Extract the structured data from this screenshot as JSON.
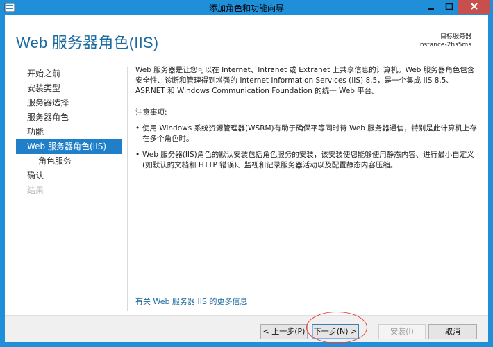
{
  "window": {
    "title": "添加角色和功能向导",
    "controls": {
      "minimize": "minimize-icon",
      "maximize": "maximize-icon",
      "close": "close-icon"
    }
  },
  "header": {
    "page_title": "Web 服务器角色(IIS)",
    "target_label": "目标服务器",
    "target_server": "instance-2hs5ms"
  },
  "nav": {
    "items": [
      {
        "label": "开始之前",
        "state": "normal"
      },
      {
        "label": "安装类型",
        "state": "normal"
      },
      {
        "label": "服务器选择",
        "state": "normal"
      },
      {
        "label": "服务器角色",
        "state": "normal"
      },
      {
        "label": "功能",
        "state": "normal"
      },
      {
        "label": "Web 服务器角色(IIS)",
        "state": "active"
      },
      {
        "label": "角色服务",
        "state": "sub"
      },
      {
        "label": "确认",
        "state": "normal"
      },
      {
        "label": "结果",
        "state": "disabled"
      }
    ]
  },
  "content": {
    "intro": "Web 服务器是让您可以在 Internet、Intranet 或 Extranet 上共享信息的计算机。Web 服务器角色包含安全性、诊断和管理得到增强的 Internet Information Services (IIS) 8.5，是一个集成 IIS 8.5、ASP.NET 和 Windows Communication Foundation 的统一 Web 平台。",
    "notes_title": "注意事项:",
    "bullets": [
      "使用 Windows 系统资源管理器(WSRM)有助于确保平等同时待 Web 服务器通信，特别是此计算机上存在多个角色时。",
      "Web 服务器(IIS)角色的默认安装包括角色服务的安装，该安装使您能够使用静态内容、进行最小自定义(如默认的文档和 HTTP 错误)、监视和记录服务器活动以及配置静态内容压缩。"
    ],
    "more_link": "有关 Web 服务器 IIS 的更多信息"
  },
  "footer": {
    "prev": "< 上一步(P)",
    "next": "下一步(N) >",
    "install": "安装(I)",
    "cancel": "取消"
  },
  "colors": {
    "title_bar": "#1e8fd8",
    "accent": "#1a6aa0",
    "nav_active": "#1f7fc9",
    "annotation": "#e8443a"
  }
}
